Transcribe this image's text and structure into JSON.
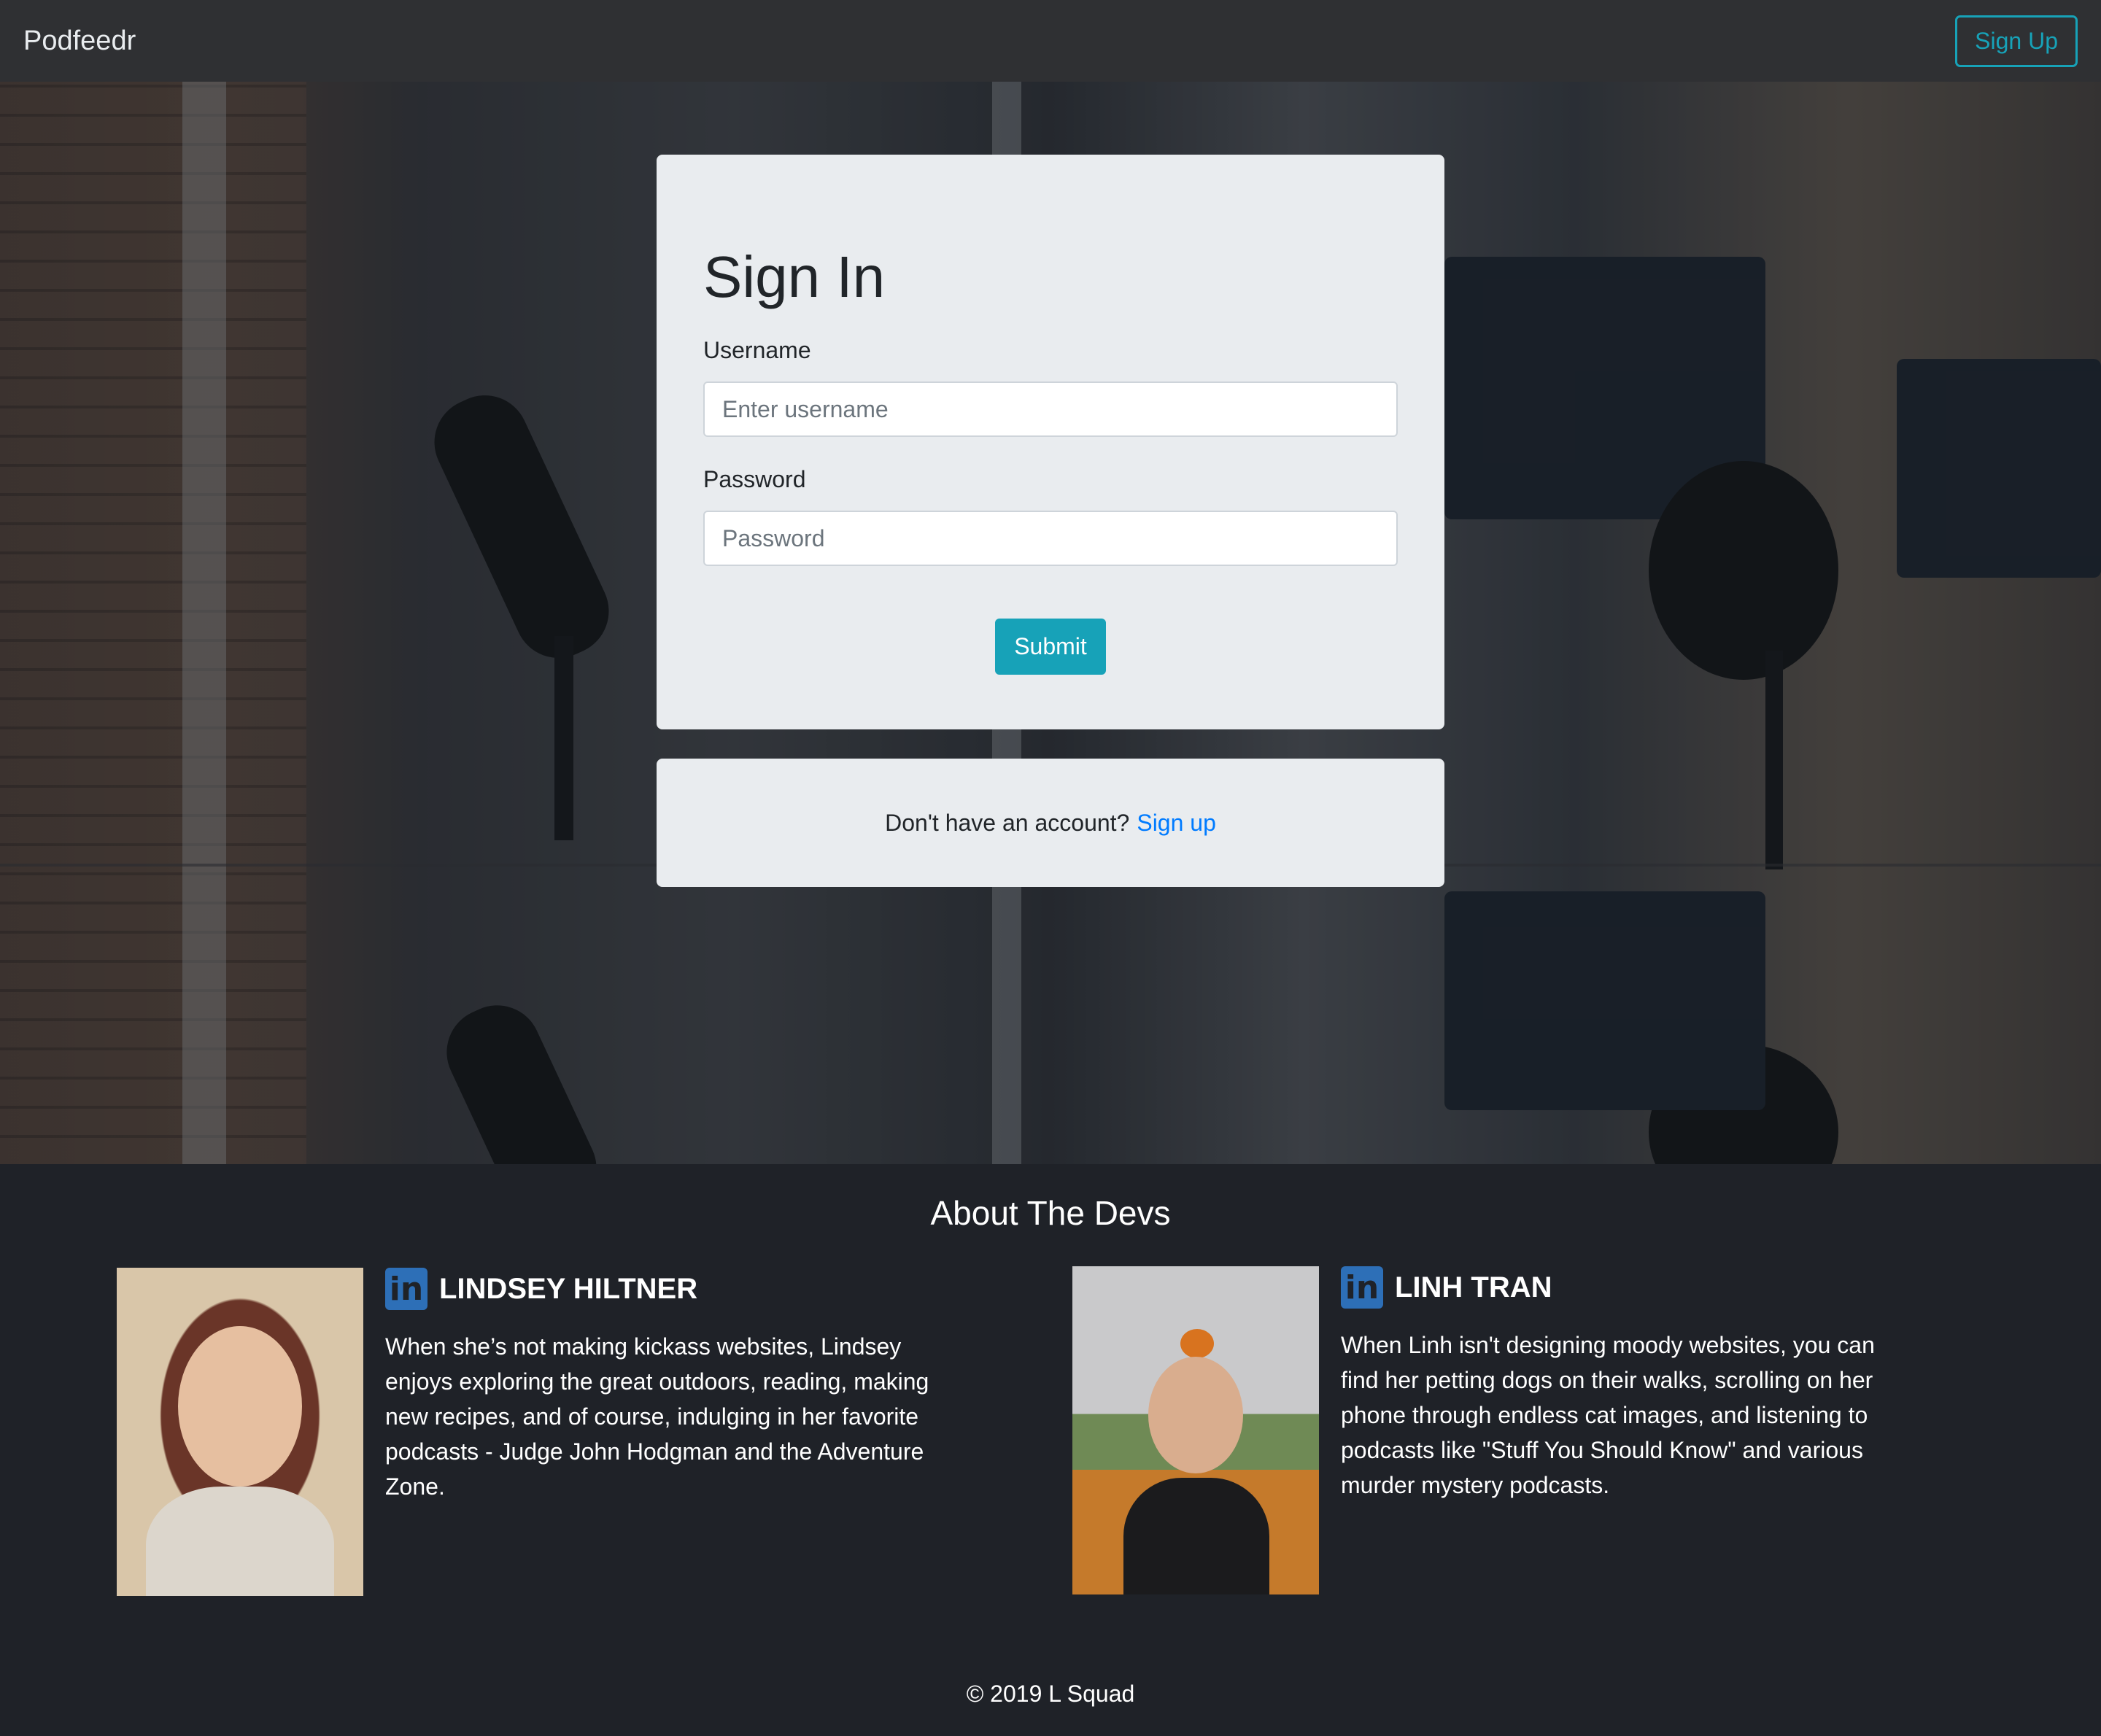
{
  "navbar": {
    "brand": "Podfeedr",
    "signup_button": "Sign Up"
  },
  "signin": {
    "title": "Sign In",
    "username_label": "Username",
    "username_placeholder": "Enter username",
    "password_label": "Password",
    "password_placeholder": "Password",
    "submit_label": "Submit"
  },
  "signup_prompt": {
    "text": "Don't have an account?",
    "link": "Sign up"
  },
  "about": {
    "title": "About The Devs",
    "devs": [
      {
        "name": "LINDSEY HILTNER",
        "bio": "When she’s not making kickass websites, Lindsey enjoys exploring the great outdoors, reading, making new recipes, and of course, indulging in her favorite podcasts - Judge John Hodgman and the Adventure Zone.",
        "icon": "linkedin-icon"
      },
      {
        "name": "LINH TRAN",
        "bio": "When Linh isn't designing moody websites, you can find her petting dogs on their walks, scrolling on her phone through endless cat images, and listening to podcasts like \"Stuff You Should Know\" and various murder mystery podcasts.",
        "icon": "linkedin-icon"
      }
    ]
  },
  "footer": {
    "text": "© 2019 L Squad"
  },
  "colors": {
    "accent": "#17a2b8",
    "link": "#007bff",
    "navbar": "#2f3033",
    "about_bg": "#1f2228",
    "card_bg": "#e9ecef",
    "linkedin": "#2d6fb7"
  }
}
